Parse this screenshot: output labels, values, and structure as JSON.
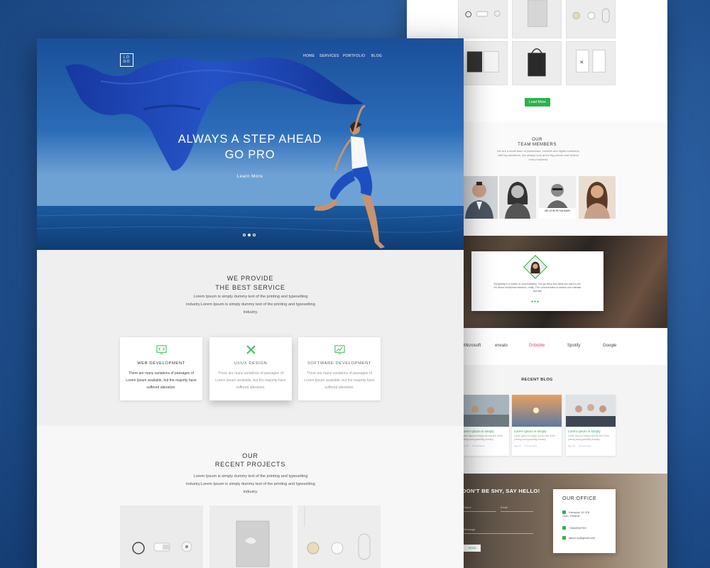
{
  "hero": {
    "logo": "LO\nGO",
    "nav": [
      "HOME",
      "SERVICES",
      "PORTFOLIO",
      "BLOG"
    ],
    "headline_1": "ALWAYS A STEP AHEAD",
    "headline_2": "GO PRO",
    "cta": "Learn More",
    "slides": 3,
    "active_slide": 2
  },
  "services": {
    "title_1": "WE PROVIDE",
    "title_2": "THE BEST SERVICE",
    "desc": "Lorem Ipsum is simply dummy text of the printing and typesetting industry.Lorem Ipsum is simply dummy text of the printing and typesetting industry.",
    "items": [
      {
        "title": "WEB DEVELOPMENT",
        "text": "There are many variations of passages of Lorem Ipsum available, but the majority have suffered alteration.",
        "icon": "monitor-code-icon"
      },
      {
        "title": "UI/UX DESIGN",
        "text": "There are many variations of passages of Lorem Ipsum available, but the majority have suffered alteration.",
        "icon": "pencil-ruler-icon"
      },
      {
        "title": "SOFTWARE DEVELOPMENT",
        "text": "There are many variations of passages of Lorem Ipsum available, but the majority have suffered alteration.",
        "icon": "monitor-chart-icon"
      }
    ]
  },
  "projects": {
    "title_1": "OUR",
    "title_2": "RECENT PROJECTS",
    "desc": "Lorem Ipsum is simply dummy text of the printing and typesetting industry.Lorem Ipsum is simply dummy text of the printing and typesetting industry."
  },
  "portfolio": {
    "load_more": "Load More"
  },
  "team": {
    "title_1": "OUR",
    "title_2": "TEAM MEMBERS",
    "desc": "We are a small team of passionate, creative and digital marketers with big ambitions. We always look at the big picture and believe every business",
    "featured_name": "MD ATIKUR RAHMAN"
  },
  "testimonial": {
    "text": "Designing is a matter of concentration. You go deep into what you want to do. It's about emotional research, really. The concentration is search and intimate and like"
  },
  "brands": [
    "Microsoft",
    "envato",
    "Dribbble",
    "Spotify",
    "Google"
  ],
  "blog": {
    "title": "RECENT BLOG",
    "posts": [
      {
        "title": "Lorem Ipsum is simply",
        "text": "Lorem Ipsum is simply dummy text of the printing and typesetting industry.",
        "date": "Sep 15",
        "comments": "5 Comments"
      },
      {
        "title": "Lorem Ipsum is simply",
        "text": "Lorem Ipsum is simply dummy text of the printing and typesetting industry.",
        "date": "Sep 15",
        "comments": "5 Comments"
      },
      {
        "title": "Lorem Ipsum is simply",
        "text": "Lorem Ipsum is simply dummy text of the printing and typesetting industry.",
        "date": "Sep 15",
        "comments": "5 Comments"
      }
    ]
  },
  "contact": {
    "title": "DON'T BE SHY, SAY HELLO!",
    "name_placeholder": "Name",
    "email_placeholder": "Email",
    "message_placeholder": "Message",
    "send": "SEND",
    "office_title": "OUR OFFICE",
    "address": "Karvanie 19 378\nOulu, Finland",
    "phone": "+3584500789",
    "email": "atikur.ux@gmail.com"
  },
  "colors": {
    "accent": "#2bb24c",
    "hero_sky": "#1f5ca8",
    "fabric": "#1e46b8"
  }
}
